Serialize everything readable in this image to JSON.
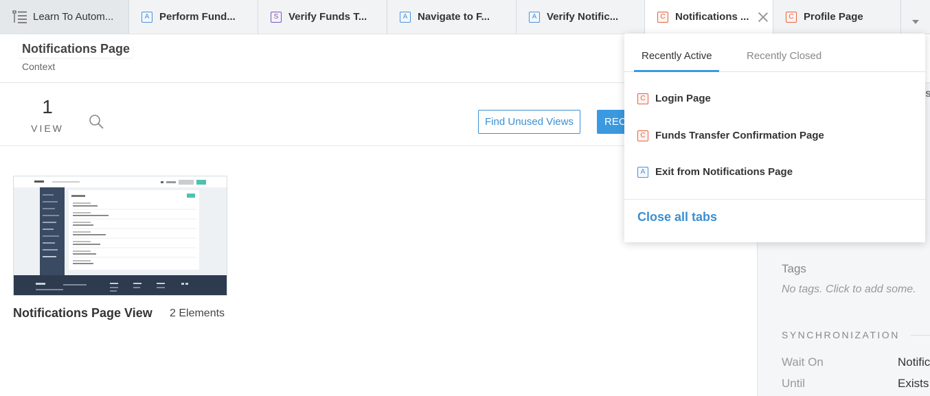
{
  "tabbar": {
    "menu_label": "Learn To Autom...",
    "tabs": [
      {
        "badge": "A",
        "kind": "a",
        "label": "Perform Fund..."
      },
      {
        "badge": "S",
        "kind": "s",
        "label": "Verify Funds T..."
      },
      {
        "badge": "A",
        "kind": "a",
        "label": "Navigate to F..."
      },
      {
        "badge": "A",
        "kind": "a",
        "label": "Verify Notific..."
      },
      {
        "badge": "C",
        "kind": "c",
        "label": "Notifications ..."
      },
      {
        "badge": "C",
        "kind": "c",
        "label": "Profile Page"
      }
    ],
    "active_index": 4
  },
  "header": {
    "title": "Notifications Page",
    "subtitle": "Context"
  },
  "toolbar": {
    "view_count": "1",
    "view_label": "VIEW",
    "find_unused": "Find Unused Views",
    "record_label": "REC"
  },
  "views": [
    {
      "name": "Notifications Page View",
      "elements": "2 Elements"
    }
  ],
  "dropdown": {
    "tab_active": "Recently Active",
    "tab_closed": "Recently Closed",
    "items": [
      {
        "badge": "C",
        "kind": "c",
        "label": "Login Page"
      },
      {
        "badge": "C",
        "kind": "c",
        "label": "Funds Transfer Confirmation Page"
      },
      {
        "badge": "A",
        "kind": "a",
        "label": "Exit from Notifications Page"
      }
    ],
    "close_all": "Close all tabs"
  },
  "details": {
    "partial_letter": "s",
    "tags_label": "Tags",
    "tags_empty": "No tags. Click to add some.",
    "sync_heading": "SYNCHRONIZATION",
    "wait_on_label": "Wait On",
    "wait_on_value": "Notific",
    "until_label": "Until",
    "until_value": "Exists"
  },
  "colors": {
    "accent": "#3b99e0",
    "badge_a": "#4a90d9",
    "badge_s": "#7b55b5",
    "badge_c": "#e5623f"
  }
}
